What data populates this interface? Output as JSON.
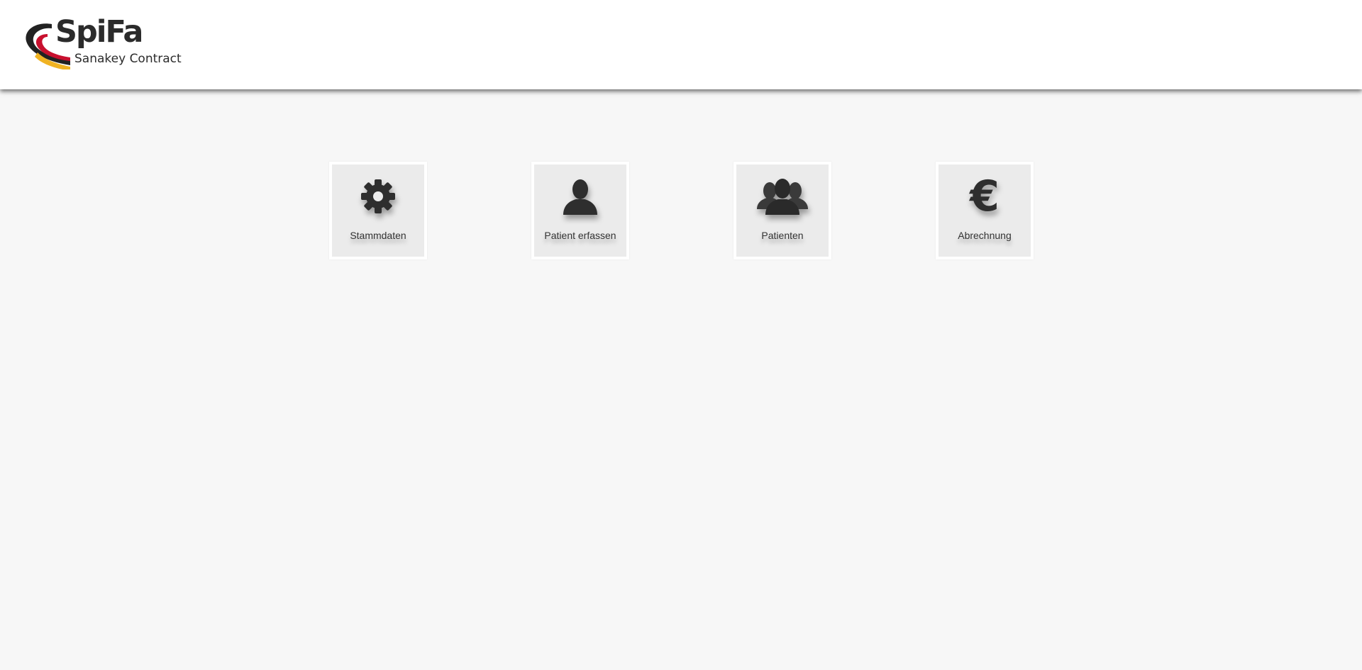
{
  "header": {
    "logo": {
      "title": "SpiFa",
      "subtitle": "Sanakey Contract",
      "colors": {
        "dark": "#222222",
        "red": "#c8102e",
        "yellow": "#f0b323"
      }
    }
  },
  "tiles": [
    {
      "label": "Stammdaten",
      "icon": "gear-icon"
    },
    {
      "label": "Patient erfassen",
      "icon": "user-icon"
    },
    {
      "label": "Patienten",
      "icon": "users-icon"
    },
    {
      "label": "Abrechnung",
      "icon": "euro-icon",
      "glyph": "€"
    }
  ]
}
